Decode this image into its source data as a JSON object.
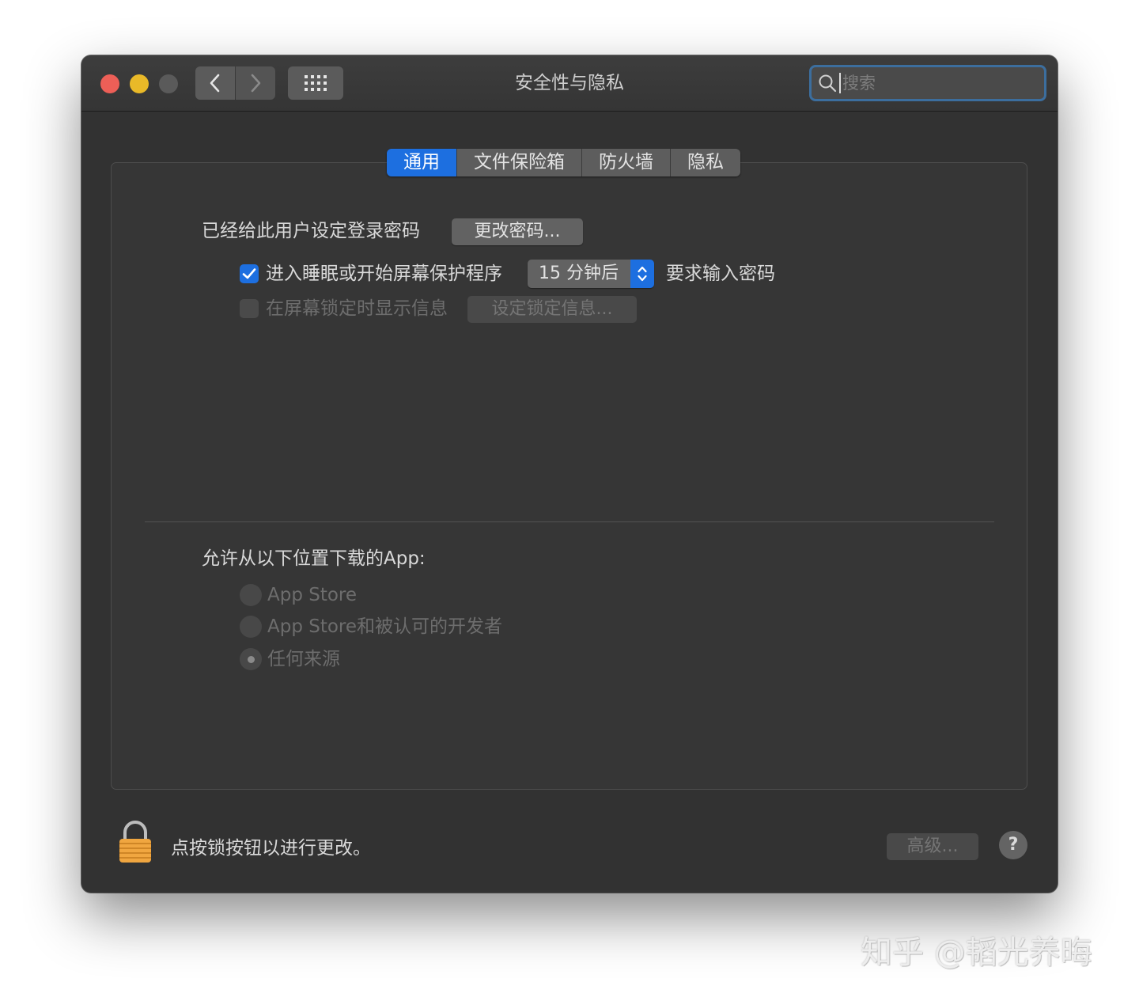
{
  "window": {
    "title": "安全性与隐私",
    "traffic_lights": {
      "close_color": "#ed5f57",
      "minimize_color": "#e9b928",
      "zoom_color": "#5a5a5a"
    },
    "search": {
      "placeholder": "搜索",
      "value": ""
    }
  },
  "tabs": [
    {
      "label": "通用",
      "active": true
    },
    {
      "label": "文件保险箱",
      "active": false
    },
    {
      "label": "防火墙",
      "active": false
    },
    {
      "label": "隐私",
      "active": false
    }
  ],
  "general": {
    "password_label": "已经给此用户设定登录密码",
    "change_password_button": "更改密码...",
    "require_password": {
      "checked": true,
      "label_before": "进入睡眠或开始屏幕保护程序",
      "delay_value": "15 分钟后",
      "label_after": "要求输入密码"
    },
    "lock_message": {
      "checked": false,
      "enabled": false,
      "label": "在屏幕锁定时显示信息",
      "button": "设定锁定信息..."
    }
  },
  "downloads": {
    "label": "允许从以下位置下载的App:",
    "options": [
      {
        "label": "App Store",
        "selected": false
      },
      {
        "label": "App Store和被认可的开发者",
        "selected": false
      },
      {
        "label": "任何来源",
        "selected": true
      }
    ]
  },
  "footer": {
    "lock_text": "点按锁按钮以进行更改。",
    "advanced_button": "高级...",
    "help_label": "?"
  },
  "accent_color": "#1d6fe0",
  "watermark": "知乎 @韬光养晦"
}
